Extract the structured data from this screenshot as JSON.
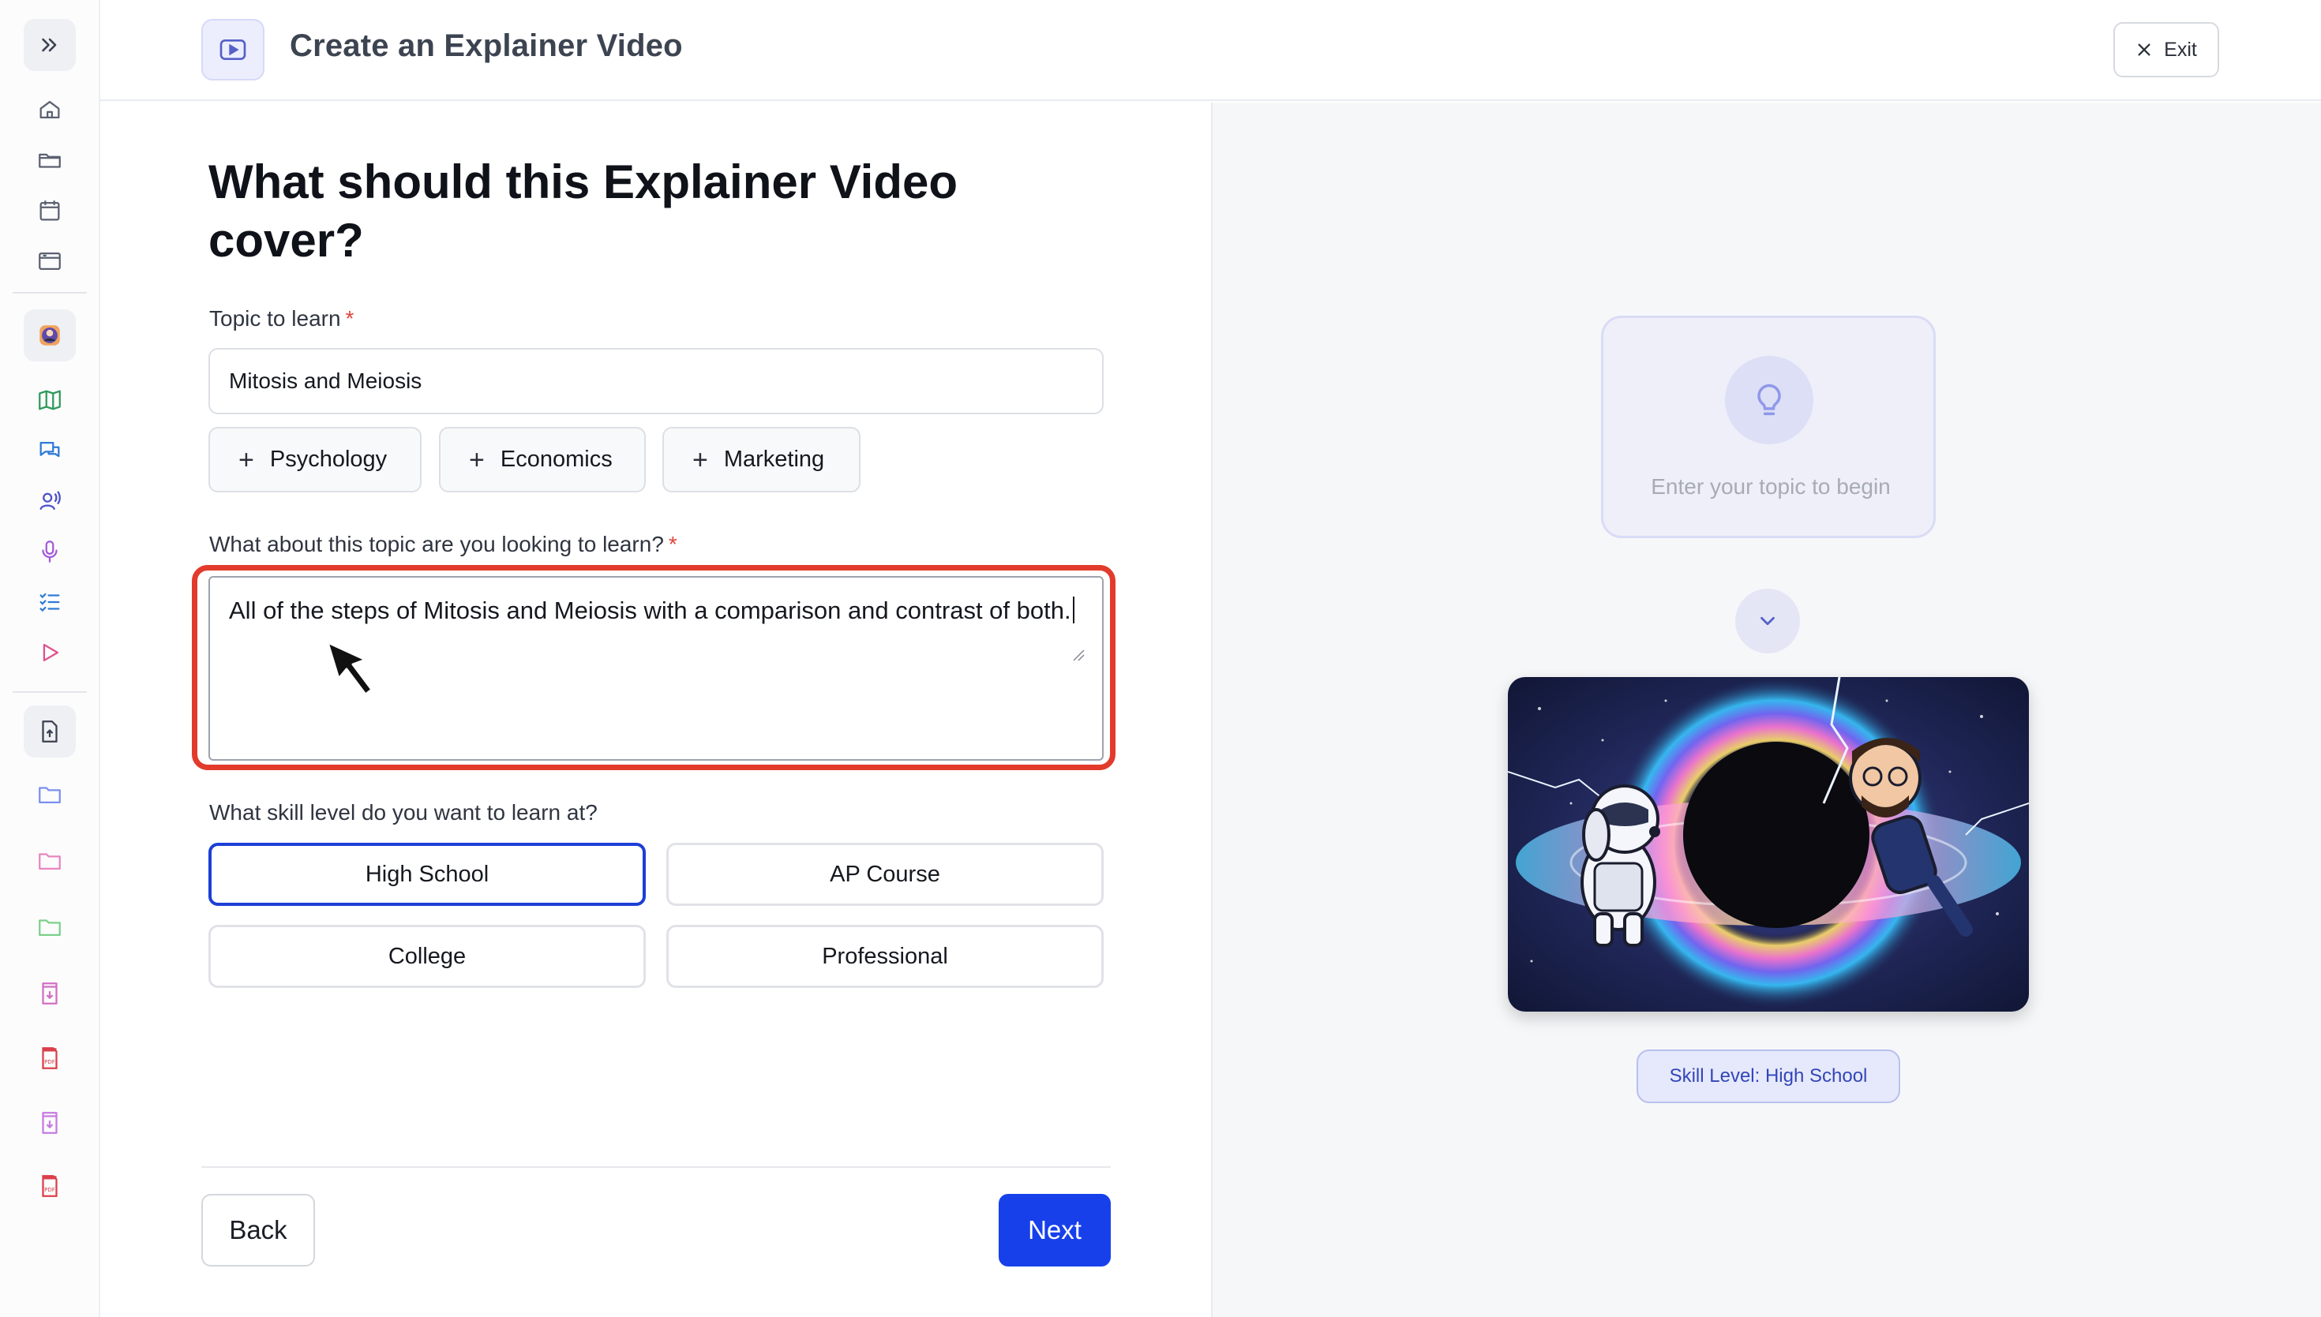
{
  "header": {
    "title": "Create an Explainer Video",
    "exit_label": "Exit"
  },
  "sidebar": {
    "items": [
      {
        "icon": "expand-icon"
      },
      {
        "icon": "home-icon"
      },
      {
        "icon": "folder-open-icon"
      },
      {
        "icon": "calendar-icon"
      },
      {
        "icon": "browser-icon"
      },
      {
        "icon": "profile-avatar-icon"
      },
      {
        "icon": "map-icon"
      },
      {
        "icon": "chat-icon"
      },
      {
        "icon": "voice-icon"
      },
      {
        "icon": "microphone-icon"
      },
      {
        "icon": "checklist-icon"
      },
      {
        "icon": "play-icon"
      },
      {
        "icon": "upload-icon"
      },
      {
        "icon": "folder-icon"
      },
      {
        "icon": "folder-icon"
      },
      {
        "icon": "folder-icon"
      },
      {
        "icon": "download-file-icon"
      },
      {
        "icon": "pdf-icon"
      },
      {
        "icon": "download-file-icon"
      },
      {
        "icon": "pdf-icon"
      }
    ]
  },
  "form": {
    "question": "What should this Explainer Video cover?",
    "topic_label": "Topic to learn",
    "required_mark": "*",
    "topic_value": "Mitosis and Meiosis",
    "suggestions": [
      {
        "label": "Psychology"
      },
      {
        "label": "Economics"
      },
      {
        "label": "Marketing"
      }
    ],
    "details_label": "What about this topic are you looking to learn?",
    "details_value": "All of the steps of Mitosis and Meiosis with a comparison and contrast of both.",
    "skill_label": "What skill level do you want to learn at?",
    "skill_options": [
      {
        "label": "High School",
        "selected": true
      },
      {
        "label": "AP Course",
        "selected": false
      },
      {
        "label": "College",
        "selected": false
      },
      {
        "label": "Professional",
        "selected": false
      }
    ],
    "back_label": "Back",
    "next_label": "Next"
  },
  "preview": {
    "hint": "Enter your topic to begin",
    "skill_pill": "Skill Level: High School"
  },
  "colors": {
    "accent": "#1740eb",
    "highlight": "#e23b2c",
    "required": "#e0453a"
  }
}
